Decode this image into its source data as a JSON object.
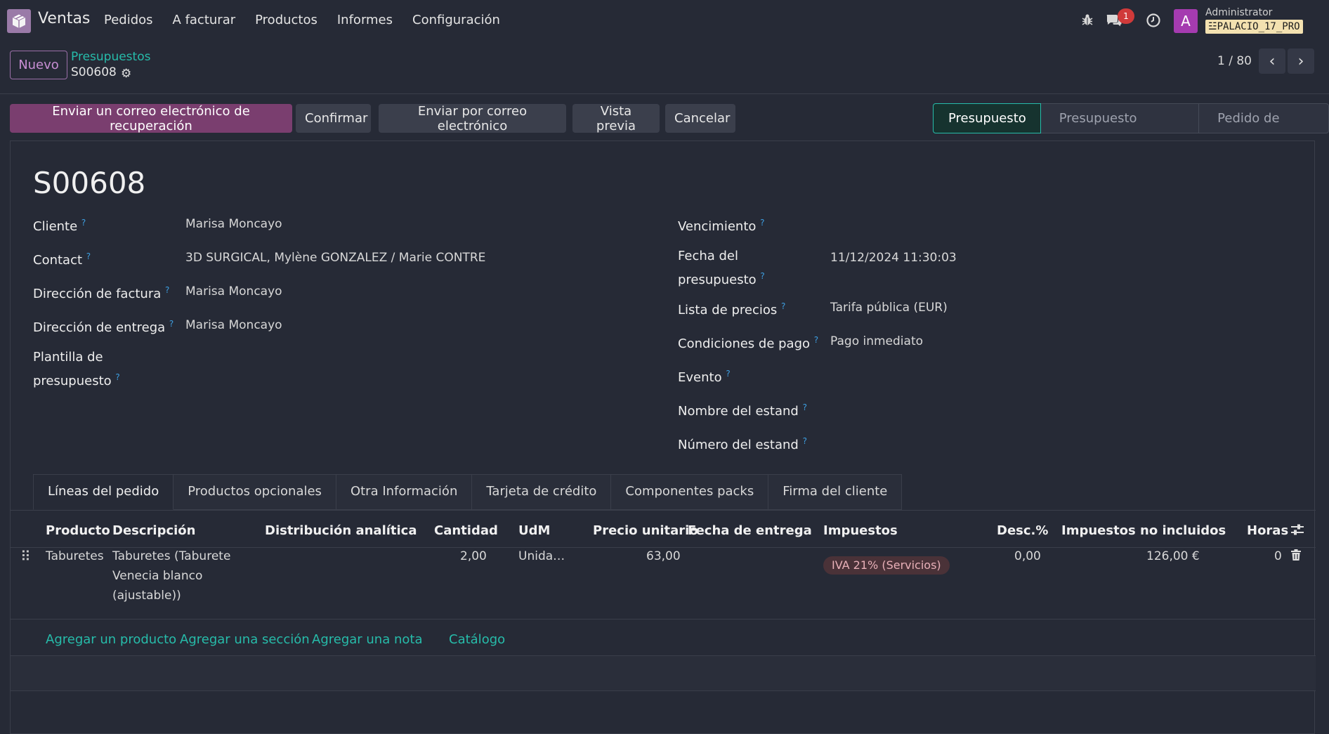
{
  "navbar": {
    "app_name": "Ventas",
    "menu": [
      "Pedidos",
      "A facturar",
      "Productos",
      "Informes",
      "Configuración"
    ],
    "chat_count": "1",
    "avatar_letter": "A",
    "user_name": "Administrator",
    "database": "PALACIO_17_PRO"
  },
  "control_panel": {
    "new_label": "Nuevo",
    "breadcrumb_parent": "Presupuestos",
    "breadcrumb_current": "S00608",
    "pager": "1 / 80"
  },
  "statusbar": {
    "buttons": [
      "Enviar un correo electrónico de recuperación",
      "Confirmar",
      "Enviar por correo electrónico",
      "Vista previa",
      "Cancelar"
    ],
    "stages": [
      "Presupuesto",
      "Presupuesto enviado",
      "Pedido de venta"
    ],
    "active_stage": "Presupuesto"
  },
  "form": {
    "title": "S00608",
    "left": {
      "cliente_label": "Cliente",
      "cliente_value": "Marisa Moncayo",
      "contact_label": "Contact",
      "contact_value": "3D SURGICAL, Mylène GONZALEZ / Marie CONTRE",
      "factura_label": "Dirección de factura",
      "factura_value": "Marisa Moncayo",
      "entrega_label": "Dirección de entrega",
      "entrega_value": "Marisa Moncayo",
      "plantilla_label_1": "Plantilla de",
      "plantilla_label_2": "presupuesto"
    },
    "right": {
      "vencimiento_label": "Vencimiento",
      "fecha_label_1": "Fecha del",
      "fecha_label_2": "presupuesto",
      "fecha_value": "11/12/2024 11:30:03",
      "lista_label": "Lista de precios",
      "lista_value": "Tarifa pública (EUR)",
      "condiciones_label": "Condiciones de pago",
      "condiciones_value": "Pago inmediato",
      "evento_label": "Evento",
      "nombre_estand_label": "Nombre del estand",
      "numero_estand_label": "Número del estand"
    },
    "help_mark": "?"
  },
  "tabs": [
    "Líneas del pedido",
    "Productos opcionales",
    "Otra Información",
    "Tarjeta de crédito",
    "Componentes packs",
    "Firma del cliente"
  ],
  "table": {
    "headers": {
      "producto": "Producto",
      "descripcion": "Descripción",
      "analitica": "Distribución analítica",
      "cantidad": "Cantidad",
      "udm": "UdM",
      "precio": "Precio unitario",
      "fecha_entrega": "Fecha de entrega",
      "impuestos": "Impuestos",
      "desc": "Desc.%",
      "subtotal": "Impuestos no incluidos",
      "horas": "Horas"
    },
    "row": {
      "producto": "Taburetes",
      "descripcion_1": "Taburetes (Taburete",
      "descripcion_2": "Venecia blanco",
      "descripcion_3": "(ajustable))",
      "cantidad": "2,00",
      "udm": "Unida…",
      "precio": "63,00",
      "impuestos": "IVA 21% (Servicios)",
      "desc": "0,00",
      "subtotal": "126,00 €",
      "horas": "0"
    },
    "links": [
      "Agregar un producto",
      "Agregar una sección",
      "Agregar una nota",
      "Catálogo"
    ]
  },
  "colors": {
    "accent": "#26bcaa",
    "primary_button": "#7a3e6f",
    "background": "#262a36"
  }
}
